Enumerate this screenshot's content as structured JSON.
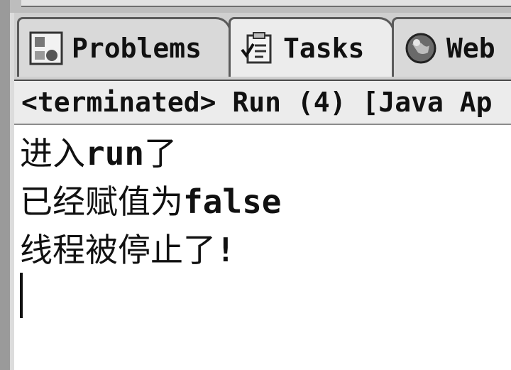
{
  "tabs": [
    {
      "label": "Problems",
      "icon": "problems-icon",
      "active": false
    },
    {
      "label": "Tasks",
      "icon": "tasks-icon",
      "active": true
    },
    {
      "label": "Web",
      "icon": "web-browser-icon",
      "active": false
    }
  ],
  "status": {
    "text": "<terminated> Run (4) [Java Ap"
  },
  "console": {
    "lines": [
      {
        "cjk": "进入",
        "latin": "run",
        "cjk2": "了"
      },
      {
        "cjk": "已经赋值为",
        "latin": "false",
        "cjk2": ""
      },
      {
        "cjk": "线程被停止了",
        "latin": "!",
        "cjk2": ""
      }
    ]
  }
}
